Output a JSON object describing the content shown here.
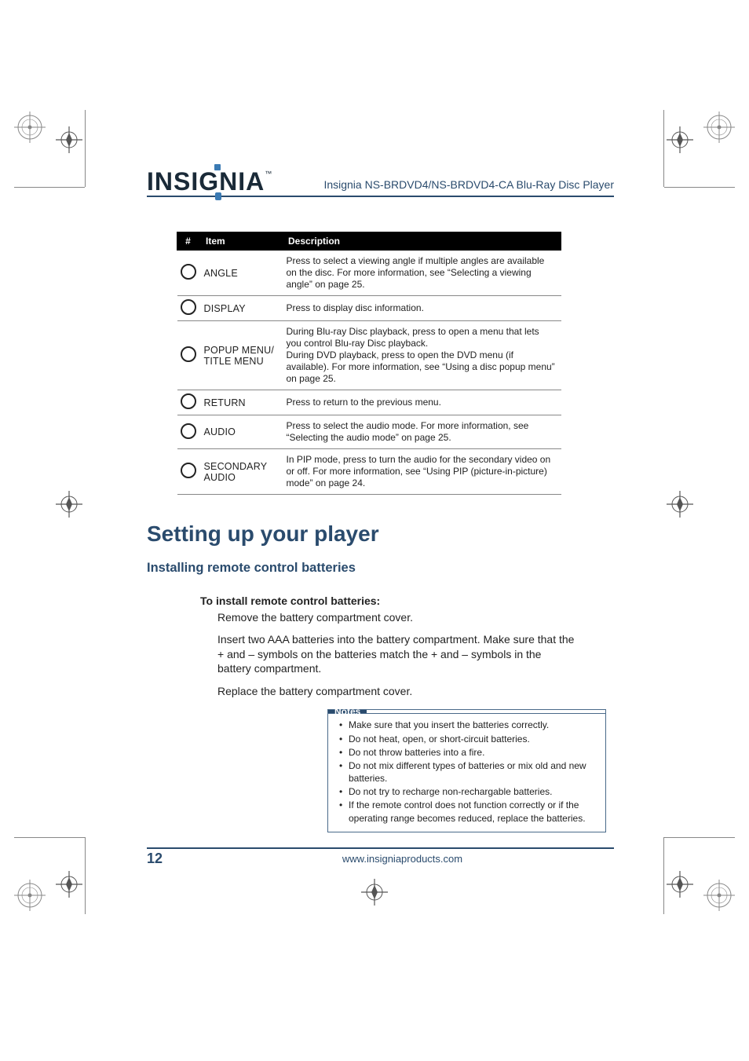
{
  "brand": "INSIGNIA",
  "brand_tm": "™",
  "header_title": "Insignia NS-BRDVD4/NS-BRDVD4-CA Blu-Ray Disc Player",
  "table": {
    "headers": {
      "num": "#",
      "item": "Item",
      "desc": "Description"
    },
    "rows": [
      {
        "item": "ANGLE",
        "desc": "Press to select a viewing angle if multiple angles are available on the disc. For more information, see “Selecting a viewing angle” on page 25."
      },
      {
        "item": "DISPLAY",
        "desc": "Press to display disc information."
      },
      {
        "item": "POPUP MENU/\nTITLE MENU",
        "desc": "During Blu-ray Disc playback, press to open a menu that lets you control Blu-ray Disc playback.\nDuring DVD playback, press to open the DVD menu (if available). For more information, see “Using a disc popup menu” on page 25."
      },
      {
        "item": "RETURN",
        "desc": "Press to return to the previous menu."
      },
      {
        "item": "AUDIO",
        "desc": "Press to select the audio mode. For more information, see “Selecting the audio mode” on page 25."
      },
      {
        "item": "SECONDARY AUDIO",
        "desc": "In PIP mode, press to turn the audio for the secondary video on or off. For more information, see “Using PIP (picture-in-picture) mode” on page 24."
      }
    ]
  },
  "h1": "Setting up your player",
  "h2": "Installing remote control batteries",
  "h3": "To install remote control batteries:",
  "steps": [
    "Remove the battery compartment cover.",
    "Insert two AAA batteries into the battery compartment. Make sure that the + and – symbols on the batteries match the + and – symbols in the battery compartment.",
    "Replace the battery compartment cover."
  ],
  "notes_label": "Notes",
  "notes": [
    "Make sure that you insert the batteries correctly.",
    "Do not heat, open, or short-circuit batteries.",
    "Do not throw batteries into a fire.",
    "Do not mix different types of batteries or mix old and new batteries.",
    "Do not try to recharge non-rechargable batteries.",
    "If the remote control does not function correctly or if the operating range becomes reduced, replace the batteries."
  ],
  "footer": {
    "page": "12",
    "url": "www.insigniaproducts.com"
  }
}
